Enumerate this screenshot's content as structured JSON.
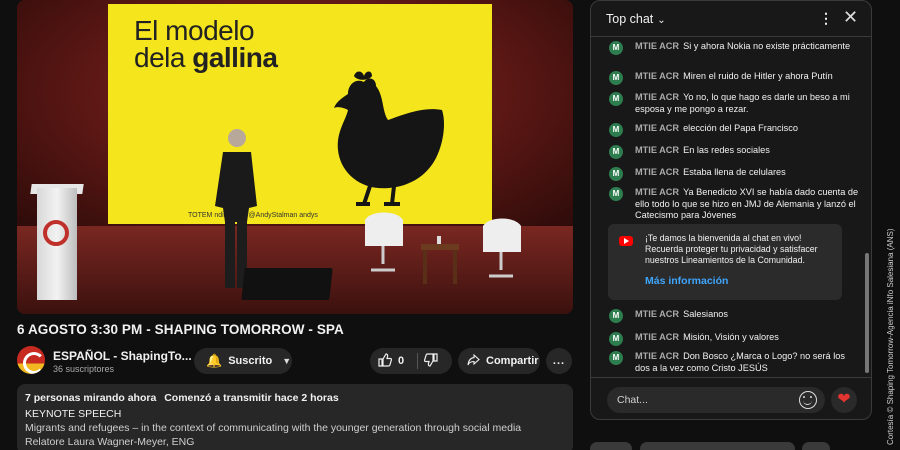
{
  "video": {
    "slide_title_line1": "El modelo",
    "slide_title_line2_prefix": "dela ",
    "slide_title_line2_bold": "gallina",
    "slide_footer": "TOTEM          nding.com    @AndyStalman    andys",
    "title": "6 AGOSTO 3:30 PM - SHAPING TOMORROW - SPA"
  },
  "channel": {
    "name": "ESPAÑOL - ShapingTo...",
    "subscribers": "36 suscriptores",
    "subscribe_label": "Suscrito",
    "like_count": "0",
    "share_label": "Compartir",
    "more_label": "..."
  },
  "description": {
    "viewers": "7 personas mirando ahora",
    "started": "Comenzó a transmitir hace 2 horas",
    "line1": "KEYNOTE SPEECH",
    "line2": "Migrants and refugees – in the context of communicating with the younger generation through social media",
    "line3": "Relatore Laura Wagner-Meyer, ENG"
  },
  "chat": {
    "mode": "Top chat",
    "input_placeholder": "Chat...",
    "messages": [
      {
        "author": "MTIE ACR",
        "initial": "M",
        "text": "Si y ahora Nokia no existe prácticamente"
      },
      {
        "author": "MTIE ACR",
        "initial": "M",
        "text": "Miren el ruido de Hitler y ahora Putín"
      },
      {
        "author": "MTIE ACR",
        "initial": "M",
        "text": "Yo no, lo que hago es darle un beso a mi esposa y me pongo a rezar."
      },
      {
        "author": "MTIE ACR",
        "initial": "M",
        "text": "elección del Papa Francisco"
      },
      {
        "author": "MTIE ACR",
        "initial": "M",
        "text": "En las redes sociales"
      },
      {
        "author": "MTIE ACR",
        "initial": "M",
        "text": "Estaba llena de celulares"
      },
      {
        "author": "MTIE ACR",
        "initial": "M",
        "text": "Ya Benedicto XVI se había dado cuenta de ello todo lo que se hizo en JMJ de Alemania y lanzó el Catecismo para Jóvenes"
      },
      {
        "author": "MTIE ACR",
        "initial": "M",
        "text": "Salesianos"
      },
      {
        "author": "MTIE ACR",
        "initial": "M",
        "text": "Misión, Visión y valores"
      },
      {
        "author": "MTIE ACR",
        "initial": "M",
        "text": "Don Bosco ¿Marca o Logo? no será los dos a la vez como Cristo JESÚS"
      }
    ],
    "welcome": {
      "text": "¡Te damos la bienvenida al chat en vivo! Recuerda proteger tu privacidad y satisfacer nuestros Lineamientos de la Comunidad.",
      "link": "Más información"
    }
  },
  "watermark": "Cortesía © Shaping Tomorrow-Agencia iNfo Salesiana (ANS)",
  "colors": {
    "accent_red": "#ff0000",
    "link_blue": "#3ea6ff",
    "slide_yellow": "#f5e51c",
    "chat_avatar": "#2e7d4f"
  }
}
